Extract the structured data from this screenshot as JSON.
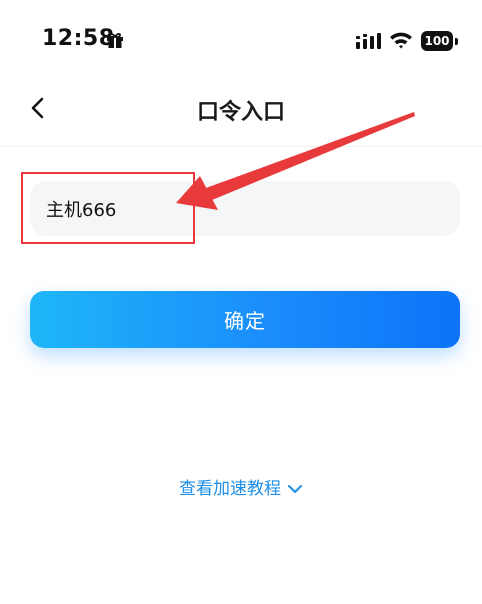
{
  "status_bar": {
    "time": "12:58",
    "battery": "100",
    "icons": [
      "gift-icon",
      "signal-icon",
      "wifi-icon",
      "battery-icon"
    ]
  },
  "nav": {
    "back_icon": "chevron-left-icon",
    "title": "口令入口"
  },
  "form": {
    "code_value": "主机666"
  },
  "actions": {
    "confirm_label": "确定"
  },
  "tutorial": {
    "label": "查看加速教程",
    "icon": "chevron-down-icon"
  },
  "colors": {
    "accent": "#1a8dfb",
    "link": "#1e8ee6",
    "annotation": "#e8393b",
    "input_bg": "#f5f6f8"
  }
}
